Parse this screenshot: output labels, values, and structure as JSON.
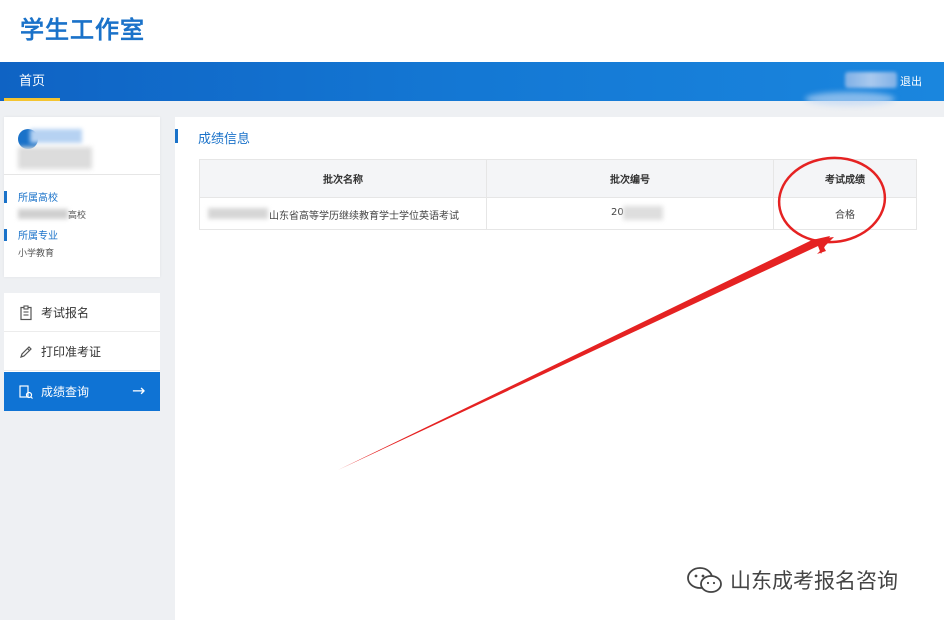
{
  "app": {
    "title": "学生工作室"
  },
  "nav": {
    "home": "首页",
    "logout": "退出"
  },
  "profile": {
    "school_label": "所属高校",
    "school_value_suffix": "高校",
    "major_label": "所属专业",
    "major_value": "小学教育"
  },
  "menu": {
    "items": [
      {
        "label": "考试报名",
        "icon": "clipboard-icon"
      },
      {
        "label": "打印准考证",
        "icon": "pencil-icon"
      },
      {
        "label": "成绩查询",
        "icon": "search-doc-icon",
        "active": true,
        "arrow": "→"
      }
    ]
  },
  "content": {
    "title": "成绩信息",
    "table": {
      "headers": [
        "批次名称",
        "批次编号",
        "考试成绩"
      ],
      "rows": [
        {
          "batch_name": "山东省高等学历继续教育学士学位英语考试",
          "batch_no": "20",
          "score": "合格"
        }
      ]
    }
  },
  "watermark": {
    "text": "山东成考报名咨询"
  },
  "colors": {
    "primary": "#1a72c9",
    "nav": "#0f63c4",
    "accent_underline": "#f4c430",
    "annotation_red": "#e52222"
  }
}
